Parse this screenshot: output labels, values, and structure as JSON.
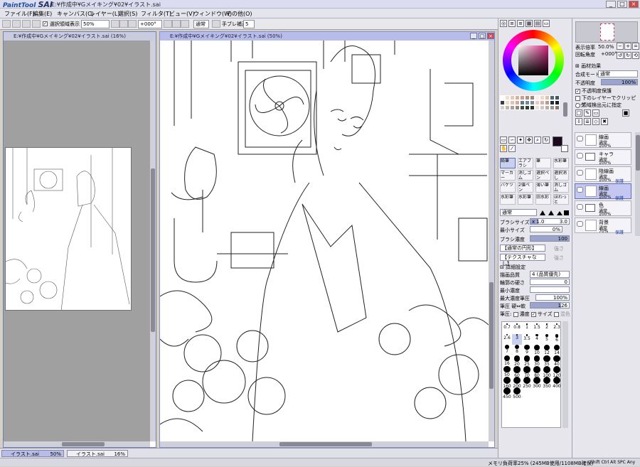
{
  "app": {
    "logo_small": "PaintTool",
    "logo_big": "SAI",
    "window_title": "E:¥作成中¥Gメイキング¥02¥イラスト.sai"
  },
  "menu": [
    "ファイル(F)",
    "編集(E)",
    "キャンバス(C)",
    "レイヤー(L)",
    "選択(S)",
    "フィルタ(T)",
    "ビュー(V)",
    "ウィンドウ(W)",
    "その他(O)"
  ],
  "toolbar": {
    "selection_label": "選択領域表示",
    "zoom": "50%",
    "rotation": "+000°",
    "mode": "通常",
    "stabilizer_label": "手ブレ補正",
    "stabilizer": "5"
  },
  "docs": {
    "left_title": "E:¥作成中¥Gメイキング¥02¥イラスト.sai (16%)",
    "main_title": "E:¥作成中¥Gメイキング¥02¥イラスト.sai (50%)"
  },
  "tasks": [
    {
      "name": "イラスト.sai",
      "zoom": "50%"
    },
    {
      "name": "イラスト.sai",
      "zoom": "16%"
    }
  ],
  "status": {
    "memory": "メモリ負荷率25% (245MB使用/1108MB確保)",
    "keys": [
      "Shift",
      "Ctrl",
      "Alt",
      "SPC",
      "Any"
    ]
  },
  "navigator": {
    "zoom_label": "表示倍率",
    "zoom": "50.0%",
    "rotation_label": "回転角度",
    "rotation": "+000°"
  },
  "layer_props": {
    "paper_effect": "画材効果",
    "blend_label": "合成モード",
    "blend": "通常",
    "opacity_label": "不透明度",
    "opacity": "100%",
    "preserve_opacity": "不透明度保護",
    "clipping": "下のレイヤーでクリッピング",
    "selection_source": "領域検出元に指定"
  },
  "layers": [
    {
      "name": "線画",
      "mode": "通常",
      "opacity": "100%",
      "kind": "layer"
    },
    {
      "name": "キャラ",
      "mode": "通常",
      "opacity": "100%",
      "kind": "folder"
    },
    {
      "name": "陰線画",
      "mode": "通常",
      "opacity": "100%",
      "extra": "保護",
      "kind": "layer"
    },
    {
      "name": "線画",
      "mode": "通常",
      "opacity": "100%",
      "extra": "保護",
      "kind": "layer",
      "selected": true
    },
    {
      "name": "色",
      "mode": "通常",
      "opacity": "100%",
      "kind": "folder"
    },
    {
      "name": "背景",
      "mode": "通常",
      "opacity": "70%",
      "extra": "保護",
      "kind": "layer"
    }
  ],
  "brushes": [
    [
      "鉛筆",
      "エアブラシ",
      "筆",
      "水彩筆"
    ],
    [
      "マーカー",
      "消しゴム",
      "選択ペン",
      "選択消し"
    ],
    [
      "バケツ",
      "2値ペン",
      "薄い筆",
      "消しゴム"
    ],
    [
      "水彩筆",
      "水彩筆",
      "旧水彩",
      "ほわっと"
    ]
  ],
  "brush_settings": {
    "mode": "通常",
    "size_label": "ブラシサイズ",
    "size_mult": "x 1.0",
    "size": "3.0",
    "min_size_label": "最小サイズ",
    "min_size": "0%",
    "density_label": "ブラシ濃度",
    "density": "100",
    "texture1": "【通常の円形】",
    "texture2": "【テクスチャなし】",
    "strength_label": "強さ",
    "detail_label": "詳細設定",
    "quality_label": "描画品質",
    "quality": "4 (品質優先)",
    "edge_label": "輪郭の硬さ",
    "edge": "0",
    "min_density_label": "最小濃度",
    "max_density_label": "最大濃度筆圧",
    "max_density": "100%",
    "pressure_label": "筆圧 硬⇔軟",
    "pressure": "126",
    "pressure2_label": "筆圧:",
    "density_cb": "濃度",
    "size_cb": "サイズ",
    "mix_cb": "混色"
  },
  "brush_sizes": [
    "0.7",
    "0.8",
    "1",
    "1.5",
    "2",
    "2.3",
    "2.6",
    "3",
    "3.5",
    "4",
    "5",
    "6",
    "7",
    "8",
    "9",
    "10",
    "12",
    "14",
    "16",
    "20",
    "25",
    "30",
    "35",
    "40",
    "50",
    "60",
    "70",
    "80",
    "100",
    "120",
    "160",
    "200",
    "250",
    "300",
    "350",
    "400",
    "450",
    "500"
  ],
  "colors": {
    "accent": "#b8bce8",
    "foreground": "#1a0a1a",
    "ring_hue": "#d0207a"
  },
  "palette": [
    "#ffffff",
    "#f0e0d0",
    "#e8c8b0",
    "#d8b0a0",
    "#c8a090",
    "#b09080",
    "#a08878",
    "#f8f0e8",
    "#f0d8c8",
    "#e0c0a8",
    "#506878",
    "#405868",
    "#304050",
    "#f8d8c8",
    "#e8c0b0",
    "#d8a898",
    "#607888",
    "#708898",
    "#8090a0",
    "#f0c8c0",
    "#e0b0a8",
    "#c09890",
    "#203040",
    "#102030",
    "#d8d0c8",
    "#c0b8b0",
    "#a8a098",
    "#908880",
    "#405040",
    "#304030",
    "#283828",
    "#e8e0d8",
    "#d0c8c0",
    "#b8b0a8",
    "#a09890",
    "#887870"
  ]
}
